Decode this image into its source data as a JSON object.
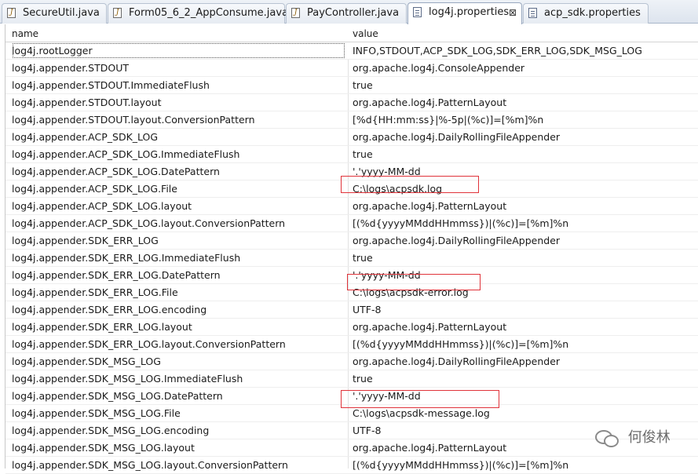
{
  "tabs": [
    {
      "label": "SecureUtil.java",
      "icon": "java-file-icon",
      "active": false
    },
    {
      "label": "Form05_6_2_AppConsume.java",
      "icon": "java-file-icon",
      "active": false
    },
    {
      "label": "PayController.java",
      "icon": "java-file-icon",
      "active": false
    },
    {
      "label": "log4j.properties",
      "icon": "properties-file-icon",
      "active": true,
      "close": "⊠"
    },
    {
      "label": "acp_sdk.properties",
      "icon": "properties-file-icon",
      "active": false
    }
  ],
  "table": {
    "headers": {
      "name": "name",
      "value": "value"
    },
    "rows": [
      {
        "name": "log4j.rootLogger",
        "value": "INFO,STDOUT,ACP_SDK_LOG,SDK_ERR_LOG,SDK_MSG_LOG"
      },
      {
        "name": "log4j.appender.STDOUT",
        "value": "org.apache.log4j.ConsoleAppender"
      },
      {
        "name": "log4j.appender.STDOUT.ImmediateFlush",
        "value": "true"
      },
      {
        "name": "log4j.appender.STDOUT.layout",
        "value": "org.apache.log4j.PatternLayout"
      },
      {
        "name": "log4j.appender.STDOUT.layout.ConversionPattern",
        "value": "[%d{HH:mm:ss}|%-5p|(%c)]=[%m]%n"
      },
      {
        "name": "log4j.appender.ACP_SDK_LOG",
        "value": "org.apache.log4j.DailyRollingFileAppender"
      },
      {
        "name": "log4j.appender.ACP_SDK_LOG.ImmediateFlush",
        "value": "true"
      },
      {
        "name": "log4j.appender.ACP_SDK_LOG.DatePattern",
        "value": "'.'yyyy-MM-dd"
      },
      {
        "name": "log4j.appender.ACP_SDK_LOG.File",
        "value": "C:\\logs\\acpsdk.log"
      },
      {
        "name": "log4j.appender.ACP_SDK_LOG.layout",
        "value": "org.apache.log4j.PatternLayout"
      },
      {
        "name": "log4j.appender.ACP_SDK_LOG.layout.ConversionPattern",
        "value": "[(%d{yyyyMMddHHmmss})|(%c)]=[%m]%n"
      },
      {
        "name": "log4j.appender.SDK_ERR_LOG",
        "value": "org.apache.log4j.DailyRollingFileAppender"
      },
      {
        "name": "log4j.appender.SDK_ERR_LOG.ImmediateFlush",
        "value": "true"
      },
      {
        "name": "log4j.appender.SDK_ERR_LOG.DatePattern",
        "value": "'.'yyyy-MM-dd"
      },
      {
        "name": "log4j.appender.SDK_ERR_LOG.File",
        "value": "C:\\logs\\acpsdk-error.log"
      },
      {
        "name": "log4j.appender.SDK_ERR_LOG.encoding",
        "value": "UTF-8"
      },
      {
        "name": "log4j.appender.SDK_ERR_LOG.layout",
        "value": "org.apache.log4j.PatternLayout"
      },
      {
        "name": "log4j.appender.SDK_ERR_LOG.layout.ConversionPattern",
        "value": "[(%d{yyyyMMddHHmmss})|(%c)]=[%m]%n"
      },
      {
        "name": "log4j.appender.SDK_MSG_LOG",
        "value": "org.apache.log4j.DailyRollingFileAppender"
      },
      {
        "name": "log4j.appender.SDK_MSG_LOG.ImmediateFlush",
        "value": "true"
      },
      {
        "name": "log4j.appender.SDK_MSG_LOG.DatePattern",
        "value": "'.'yyyy-MM-dd"
      },
      {
        "name": "log4j.appender.SDK_MSG_LOG.File",
        "value": "C:\\logs\\acpsdk-message.log"
      },
      {
        "name": "log4j.appender.SDK_MSG_LOG.encoding",
        "value": "UTF-8"
      },
      {
        "name": "log4j.appender.SDK_MSG_LOG.layout",
        "value": "org.apache.log4j.PatternLayout"
      },
      {
        "name": "log4j.appender.SDK_MSG_LOG.layout.ConversionPattern",
        "value": "[(%d{yyyyMMddHHmmss})|(%c)]=[%m]%n"
      }
    ]
  },
  "watermark": {
    "text": "何俊林",
    "icon": "wechat-icon"
  },
  "colors": {
    "highlight": "#e0333a"
  }
}
